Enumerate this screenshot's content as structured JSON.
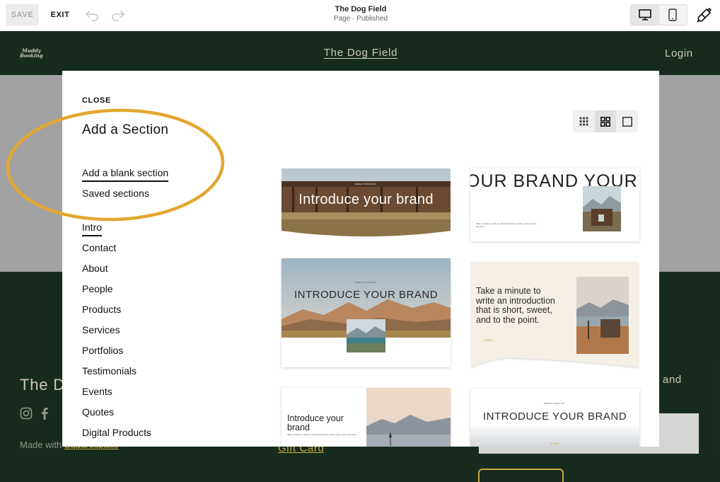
{
  "toolbar": {
    "save_label": "SAVE",
    "exit_label": "EXIT",
    "page_title": "The Dog Field",
    "page_status": "Page · Published"
  },
  "site": {
    "logo_line1": "Muddy",
    "logo_line2": "Booking",
    "title": "The Dog Field",
    "login": "Login",
    "footer_brand": "The Dog Field",
    "made_with_prefix": "Made with ",
    "made_with_link": "Squarespace",
    "gift_card": "Gift Card",
    "footer_and": "and"
  },
  "modal": {
    "close_label": "CLOSE",
    "title": "Add a Section",
    "nav": {
      "blank": "Add a blank section",
      "saved": "Saved sections"
    },
    "categories": [
      "Intro",
      "Contact",
      "About",
      "People",
      "Products",
      "Services",
      "Portfolios",
      "Testimonials",
      "Events",
      "Quotes",
      "Digital Products"
    ],
    "active_category": "Intro"
  },
  "templates": {
    "t1_heading": "Introduce your brand",
    "t2_heading": "OUR BRAND  YOUR",
    "t3_heading": "INTRODUCE YOUR BRAND",
    "t4_text": "Take a minute to write an introduction that is short, sweet, and to the point.",
    "t5_text": "Introduce your brand",
    "t6_heading": "INTRODUCE YOUR BRAND"
  },
  "colors": {
    "site_dark_green": "#1a3123",
    "site_cream": "#e9e3cf",
    "accent_gold": "#e5c14b",
    "annotation_ellipse": "#e3a72f"
  },
  "icons": {
    "undo": "undo-icon",
    "redo": "redo-icon",
    "desktop": "desktop-icon",
    "mobile": "mobile-icon",
    "style": "paintbrush-icon",
    "grid_small": "grid-small-icon",
    "grid_large": "grid-large-icon",
    "single": "single-view-icon",
    "instagram": "instagram-icon",
    "facebook": "facebook-icon"
  }
}
